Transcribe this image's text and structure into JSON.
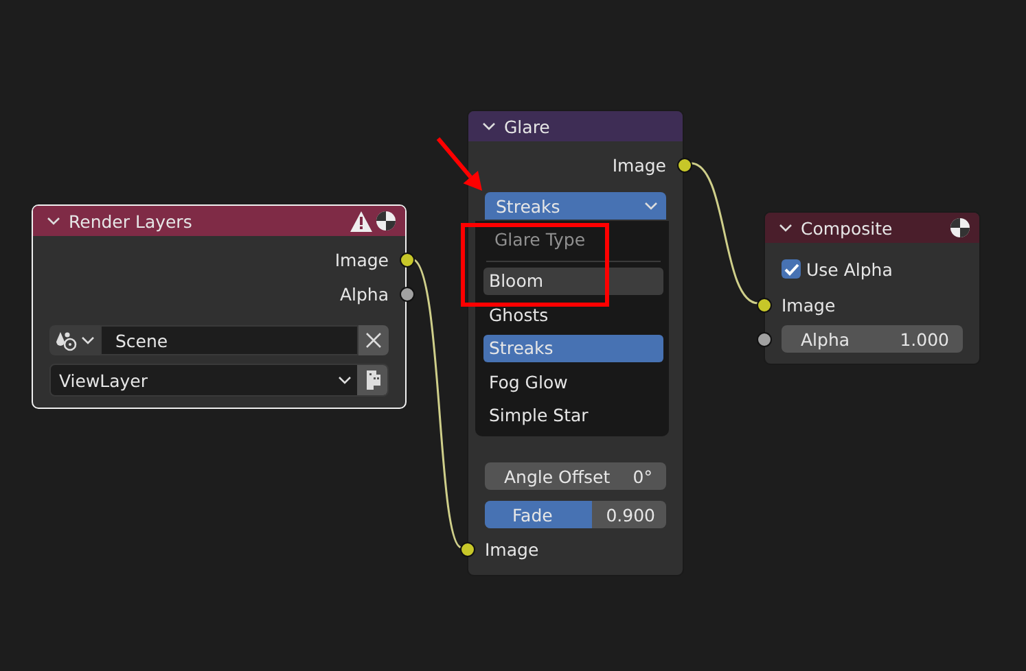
{
  "nodes": [
    {
      "title": "Render Layers",
      "color": "#7f2b46",
      "selected": true,
      "rows": [
        {
          "kind": "output",
          "label": "Image",
          "color": "#c7c729"
        },
        {
          "kind": "output",
          "label": "Alpha",
          "color": "#a1a1a1"
        },
        {
          "kind": "scene_picker",
          "value": "Scene"
        },
        {
          "kind": "layer_picker",
          "value": "ViewLayer"
        }
      ]
    },
    {
      "title": "Glare",
      "color": "#3e2d55",
      "selected": false,
      "rows": [
        {
          "kind": "output",
          "label": "Image",
          "color": "#c7c729"
        },
        {
          "kind": "dropdown",
          "value": "Streaks",
          "open": true
        },
        {
          "kind": "field",
          "label": "Angle Offset",
          "value": "0°"
        },
        {
          "kind": "slider",
          "label": "Fade",
          "value": "0.900",
          "level": 0.59
        },
        {
          "kind": "input",
          "label": "Image",
          "color": "#c7c729"
        }
      ],
      "menu": {
        "title": "Glare Type",
        "items": [
          {
            "label": "Bloom",
            "selected": false,
            "highlighted": true
          },
          {
            "label": "Ghosts",
            "selected": false,
            "highlighted": false
          },
          {
            "label": "Streaks",
            "selected": true,
            "highlighted": false
          },
          {
            "label": "Fog Glow",
            "selected": false,
            "highlighted": false
          },
          {
            "label": "Simple Star",
            "selected": false,
            "highlighted": false
          }
        ]
      }
    },
    {
      "title": "Composite",
      "color": "#4a1e2b",
      "selected": false,
      "rows": [
        {
          "kind": "checkbox",
          "label": "Use Alpha",
          "checked": true
        },
        {
          "kind": "input",
          "label": "Image",
          "color": "#c7c729"
        },
        {
          "kind": "field",
          "label": "Alpha",
          "value": "1.000",
          "color": "#a1a1a1"
        }
      ]
    }
  ],
  "annotations": [
    {
      "kind": "arrow",
      "color": "#ff0000"
    },
    {
      "kind": "box",
      "color": "#ff0000"
    }
  ]
}
